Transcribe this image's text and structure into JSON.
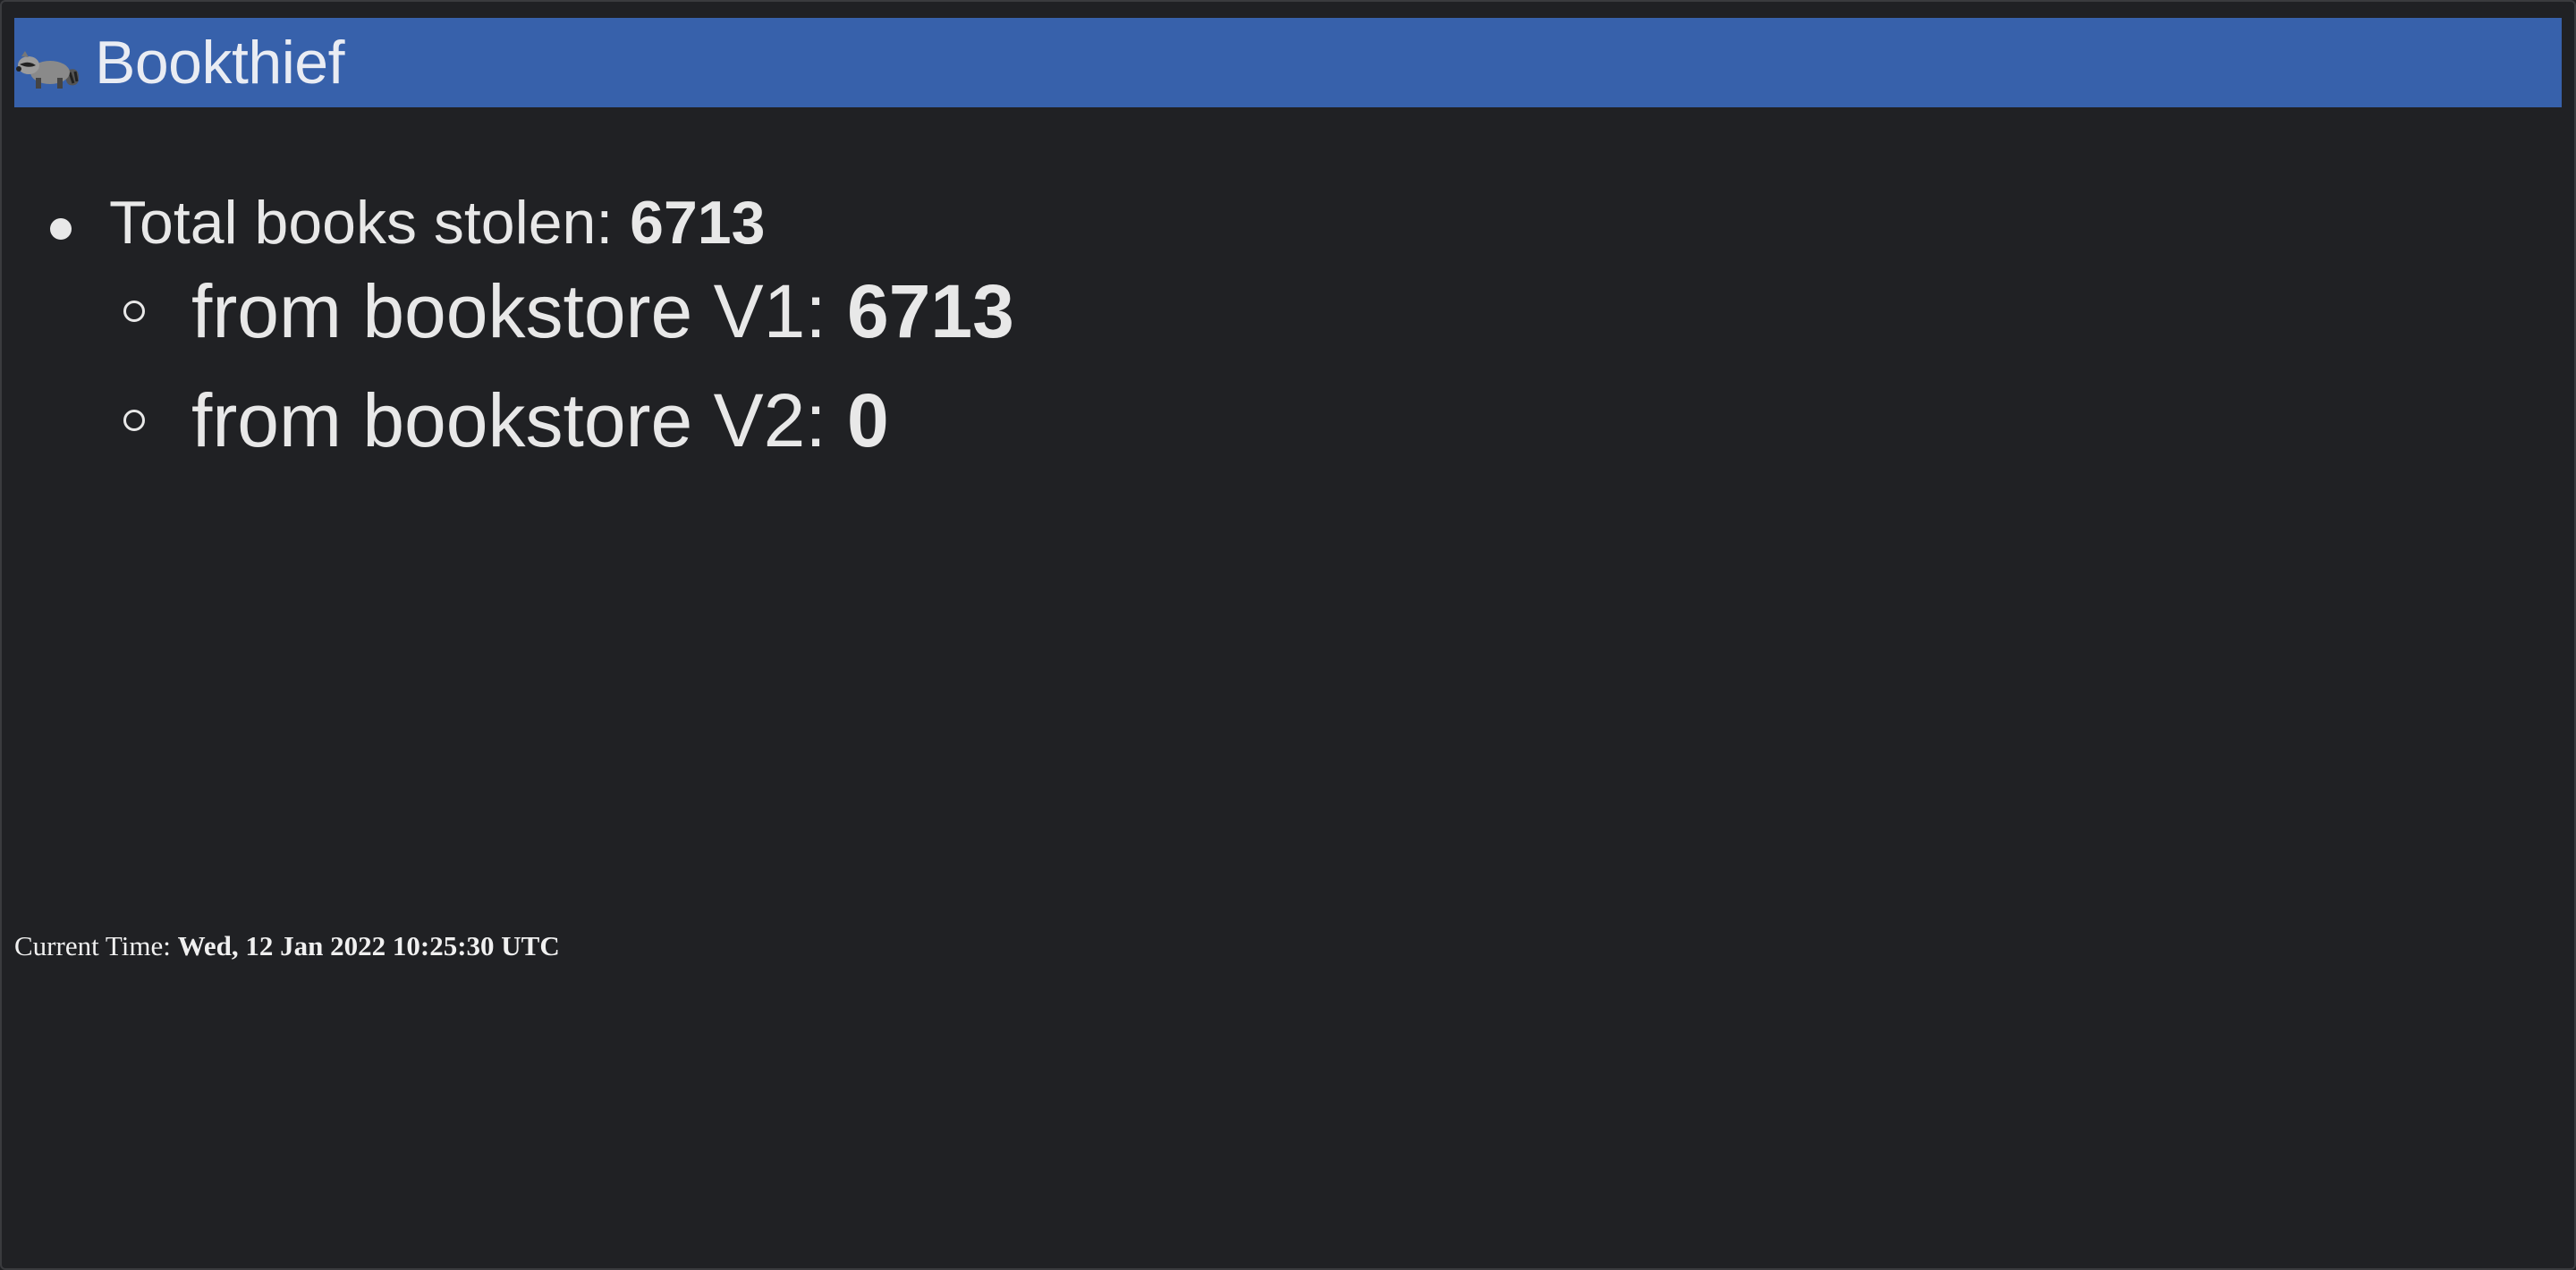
{
  "header": {
    "icon": "raccoon-icon",
    "title": "Bookthief",
    "background": "#3761ab"
  },
  "stats": {
    "total": {
      "label": "Total books stolen: ",
      "value": "6713"
    },
    "sources": [
      {
        "label": "from bookstore V1: ",
        "value": "6713"
      },
      {
        "label": "from bookstore V2: ",
        "value": "0"
      }
    ]
  },
  "footer": {
    "label": "Current Time: ",
    "value": "Wed, 12 Jan 2022 10:25:30 UTC"
  }
}
